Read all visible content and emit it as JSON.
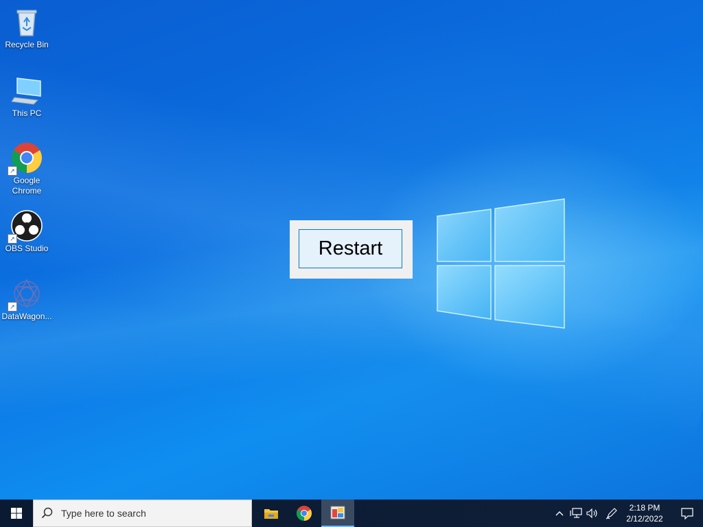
{
  "desktop": {
    "icons": [
      {
        "label": "Recycle Bin",
        "icon": "recycle-bin-icon"
      },
      {
        "label": "This PC",
        "icon": "computer-icon"
      },
      {
        "label": "Google Chrome",
        "icon": "chrome-icon",
        "shortcut": true
      },
      {
        "label": "OBS Studio",
        "icon": "obs-icon",
        "shortcut": true
      },
      {
        "label": "DataWagon...",
        "icon": "datawagon-icon",
        "shortcut": true
      }
    ]
  },
  "dialog": {
    "restart_label": "Restart"
  },
  "taskbar": {
    "search_placeholder": "Type here to search",
    "pinned": [
      "file-explorer-icon",
      "chrome-icon",
      "app-icon"
    ],
    "clock_time": "2:18 PM",
    "clock_date": "2/12/2022"
  },
  "colors": {
    "desktop_blue": "#0b6fe0",
    "taskbar": "#0f1f38",
    "button_border": "#0078d7",
    "button_bg": "#e5f1fb"
  }
}
